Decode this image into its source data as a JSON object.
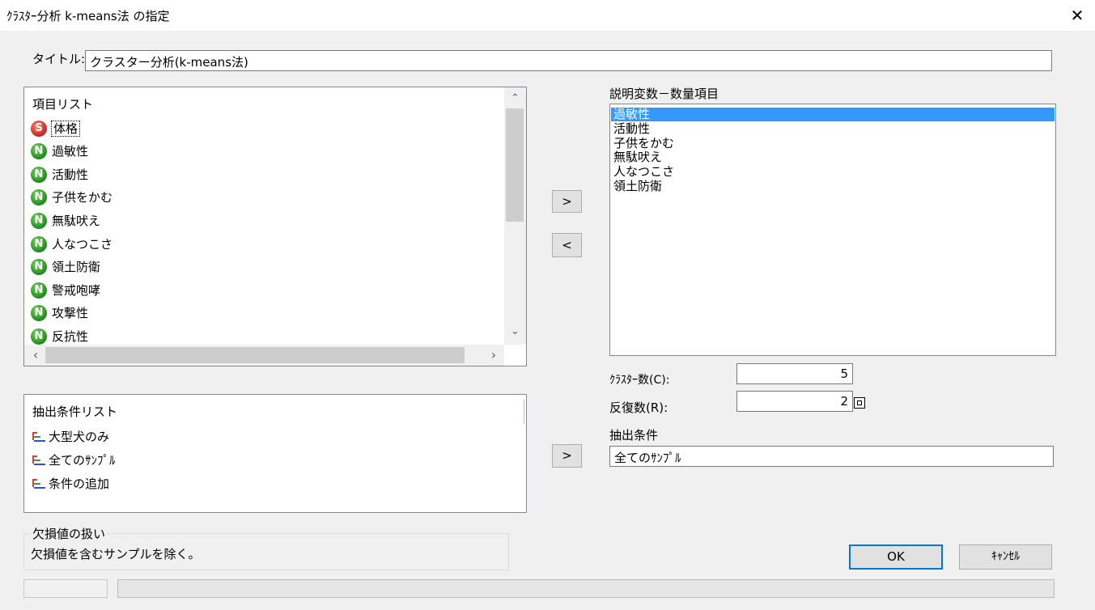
{
  "window": {
    "title": "ｸﾗｽﾀｰ分析 k-means法 の指定",
    "close_glyph": "✕"
  },
  "title_field": {
    "label": "タイトル:",
    "value": "クラスター分析(k-means法)"
  },
  "item_list": {
    "header": "項目リスト",
    "items": [
      {
        "label": "体格",
        "icon": "S"
      },
      {
        "label": "過敏性",
        "icon": "N"
      },
      {
        "label": "活動性",
        "icon": "N"
      },
      {
        "label": "子供をかむ",
        "icon": "N"
      },
      {
        "label": "無駄吠え",
        "icon": "N"
      },
      {
        "label": "人なつこさ",
        "icon": "N"
      },
      {
        "label": "領土防衛",
        "icon": "N"
      },
      {
        "label": "警戒咆哮",
        "icon": "N"
      },
      {
        "label": "攻撃性",
        "icon": "N"
      },
      {
        "label": "反抗性",
        "icon": "N"
      }
    ]
  },
  "transfer_buttons": {
    "add": ">",
    "remove": "<",
    "add_condition": ">"
  },
  "explanatory_vars": {
    "label": "説明変数－数量項目",
    "items": [
      "過敏性",
      "活動性",
      "子供をかむ",
      "無駄吠え",
      "人なつこさ",
      "領土防衛"
    ],
    "selected_index": 0
  },
  "cluster_count": {
    "label": "ｸﾗｽﾀｰ数(C):",
    "value": "5"
  },
  "iterations": {
    "label": "反復数(R):",
    "value": "2"
  },
  "condition": {
    "label": "抽出条件",
    "value": "全てのｻﾝﾌﾟﾙ"
  },
  "condition_list": {
    "header": "抽出条件リスト",
    "items": [
      "大型犬のみ",
      "全てのｻﾝﾌﾟﾙ",
      "条件の追加"
    ]
  },
  "missing": {
    "label": "欠損値の扱い",
    "text": "欠損値を含むサンプルを除く。"
  },
  "buttons": {
    "ok": "OK",
    "cancel": "ｷｬﾝｾﾙ"
  },
  "colors": {
    "selection": "#3399ff",
    "numeric_icon": "#1c8a1c",
    "string_icon": "#c62020"
  }
}
